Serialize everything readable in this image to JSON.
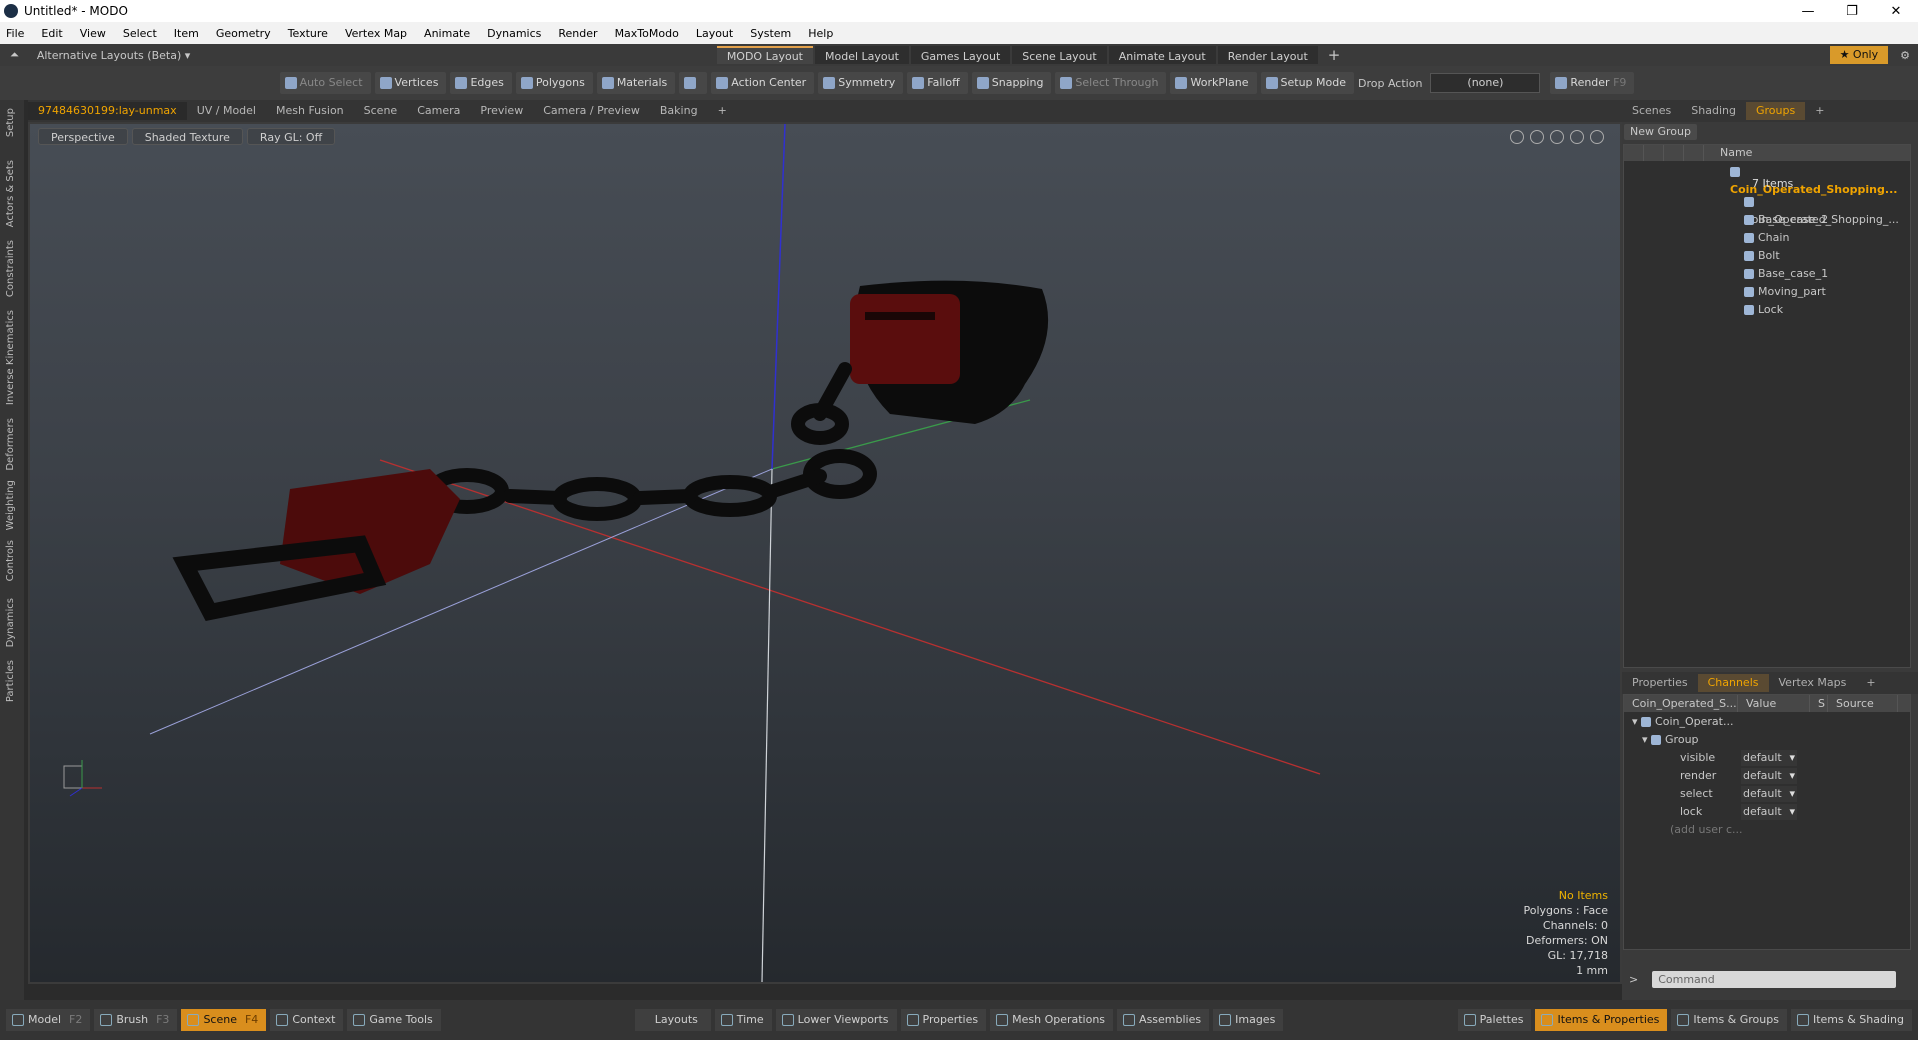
{
  "window": {
    "title": "Untitled* - MODO",
    "controls": [
      "—",
      "❐",
      "✕"
    ]
  },
  "menu": [
    "File",
    "Edit",
    "View",
    "Select",
    "Item",
    "Geometry",
    "Texture",
    "Vertex Map",
    "Animate",
    "Dynamics",
    "Render",
    "MaxToModo",
    "Layout",
    "System",
    "Help"
  ],
  "layouts": {
    "alt": "Alternative Layouts (Beta) ▾",
    "tabs": [
      "MODO Layout",
      "Model Layout",
      "Games Layout",
      "Scene Layout",
      "Animate Layout",
      "Render Layout"
    ],
    "plus": "+",
    "only": "★  Only"
  },
  "toolbar": {
    "auto_select": "Auto Select",
    "vertices": "Vertices",
    "edges": "Edges",
    "polygons": "Polygons",
    "materials": "Materials",
    "action_center": "Action Center",
    "symmetry": "Symmetry",
    "falloff": "Falloff",
    "snapping": "Snapping",
    "select_through": "Select Through",
    "workplane": "WorkPlane",
    "setup_mode": "Setup Mode",
    "drop_action": "Drop Action",
    "drop_value": "(none)",
    "render": "Render",
    "render_key": "F9"
  },
  "left_tabs": [
    "Setup",
    "Actors & Sets",
    "Constraints",
    "Inverse Kinematics",
    "Deformers",
    "Weighting",
    "Controls",
    "Dynamics",
    "Particles"
  ],
  "viewport_tabs": [
    "97484630199:lay-unmax",
    "UV / Model",
    "Mesh Fusion",
    "Scene",
    "Camera",
    "Preview",
    "Camera / Preview",
    "Baking",
    "+"
  ],
  "viewport": {
    "projection": "Perspective",
    "shading": "Shaded Texture",
    "raygl": "Ray GL: Off"
  },
  "stats": {
    "items": "No Items",
    "polygons": "Polygons : Face",
    "channels": "Channels: 0",
    "deformers": "Deformers: ON",
    "gl": "GL: 17,718",
    "unit": "1 mm"
  },
  "right_tabs_top": [
    "Scenes",
    "Shading",
    "Groups",
    "+"
  ],
  "groups": {
    "new_group": "New Group",
    "name_header": "Name",
    "root": "Coin_Operated_Shopping...",
    "count": "7 Items",
    "children": [
      "Coin_Operated_Shopping_...",
      "Base_case_2",
      "Chain",
      "Bolt",
      "Base_case_1",
      "Moving_part",
      "Lock"
    ]
  },
  "right_tabs_bottom": [
    "Properties",
    "Channels",
    "Vertex Maps",
    "+"
  ],
  "channels": {
    "headers": [
      "Coin_Operated_S...",
      "Value",
      "S",
      "Source"
    ],
    "root": "Coin_Operat...",
    "group": "Group",
    "rows": [
      {
        "name": "visible",
        "value": "default"
      },
      {
        "name": "render",
        "value": "default"
      },
      {
        "name": "select",
        "value": "default"
      },
      {
        "name": "lock",
        "value": "default"
      }
    ],
    "add": "(add user c..."
  },
  "command": {
    "arrow": ">",
    "placeholder": "Command"
  },
  "bottom": {
    "model": "Model",
    "model_key": "F2",
    "brush": "Brush",
    "brush_key": "F3",
    "scene": "Scene",
    "scene_key": "F4",
    "context": "Context",
    "game_tools": "Game Tools",
    "layouts": "Layouts",
    "time": "Time",
    "lower_viewports": "Lower Viewports",
    "properties": "Properties",
    "mesh_operations": "Mesh Operations",
    "assemblies": "Assemblies",
    "images": "Images",
    "palettes": "Palettes",
    "items_properties": "Items & Properties",
    "items_groups": "Items & Groups",
    "items_shading": "Items & Shading"
  }
}
